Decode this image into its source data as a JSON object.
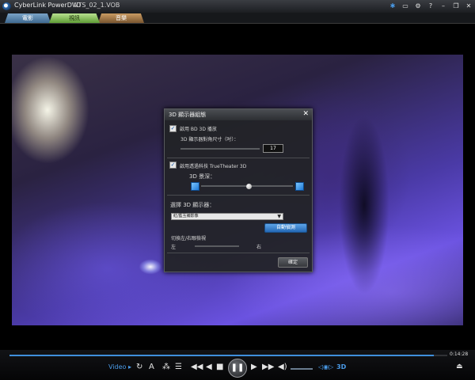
{
  "window": {
    "app_title": "CyberLink PowerDVD",
    "file_title": "VTS_02_1.VOB"
  },
  "tabs": [
    {
      "label": "電影"
    },
    {
      "label": "視訊"
    },
    {
      "label": "音樂"
    }
  ],
  "dialog": {
    "title": "3D 顯示器組態",
    "enable_bd3d_label": "啟用 BD 3D 播放",
    "screen_size_label": "3D 顯示器對角尺寸（吋）：",
    "screen_size_value": "17",
    "enable_truetheater_label": "啟用透過科技 TrueTheater 3D",
    "depth_label": "3D 景深：",
    "depth_level": 0.52,
    "select_display_label": "選擇 3D 顯示器：",
    "display_selected": "紅/藍互補影像",
    "auto_detect_button": "自動偵測",
    "swap_label": "切換左/右眼檢視",
    "left_label": "左",
    "right_label": "右",
    "ok_button": "確定"
  },
  "player": {
    "time": "0:14:28",
    "progress": 0.97,
    "video_label": "Video",
    "label_3d": "3D"
  },
  "colors": {
    "accent": "#4a9be8",
    "tab_video": "#7fbf4d"
  }
}
